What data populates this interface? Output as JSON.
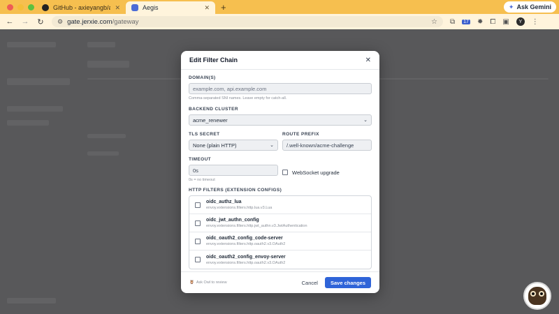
{
  "browser": {
    "tabs": [
      {
        "title": "GitHub - axieyangb/aegis: Se",
        "active": false
      },
      {
        "title": "Aegis",
        "active": true
      }
    ],
    "new_tab": "+",
    "ask_gemini": "Ask Gemini",
    "url_host": "gate.jerxie.com",
    "url_path": "/gateway",
    "ext_badge": "17",
    "profile_initial": "Y"
  },
  "modal": {
    "title": "Edit Filter Chain",
    "domains": {
      "label": "DOMAIN(S)",
      "value": "",
      "placeholder": "example.com, api.example.com",
      "hint": "Comma-separated SNI names. Leave empty for catch-all."
    },
    "backend_cluster": {
      "label": "BACKEND CLUSTER",
      "selected": "acme_renewer"
    },
    "tls_secret": {
      "label": "TLS SECRET",
      "selected": "None (plain HTTP)"
    },
    "route_prefix": {
      "label": "ROUTE PREFIX",
      "value": "/.well-known/acme-challenge"
    },
    "timeout": {
      "label": "TIMEOUT",
      "value": "0s",
      "hint": "0s = no timeout"
    },
    "websocket": {
      "label": "WebSocket upgrade",
      "checked": false
    },
    "http_filters": {
      "label": "HTTP FILTERS (EXTENSION CONFIGS)",
      "items": [
        {
          "name": "oidc_authz_lua",
          "type": "envoy.extensions.filters.http.lua.v3.Lua",
          "checked": false
        },
        {
          "name": "oidc_jwt_authn_config",
          "type": "envoy.extensions.filters.http.jwt_authn.v3.JwtAuthentication",
          "checked": false
        },
        {
          "name": "oidc_oauth2_config_code-server",
          "type": "envoy.extensions.filters.http.oauth2.v3.OAuth2",
          "checked": false
        },
        {
          "name": "oidc_oauth2_config_envoy-server",
          "type": "envoy.extensions.filters.http.oauth2.v3.OAuth2",
          "checked": false
        }
      ]
    },
    "footer": {
      "hint": "Ask Owl to review",
      "cancel_label": "Cancel",
      "save_label": "Save changes"
    }
  }
}
